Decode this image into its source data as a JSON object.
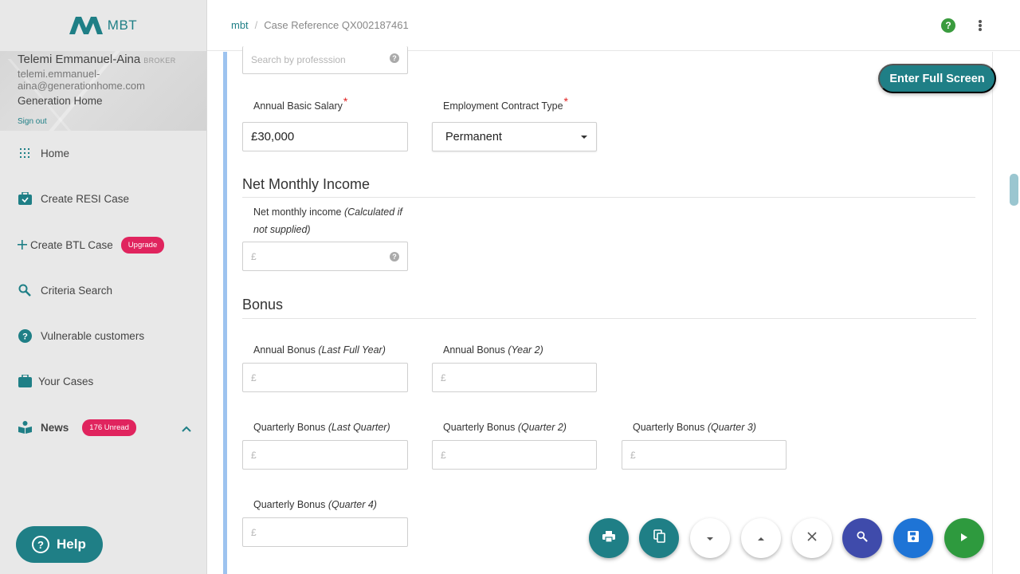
{
  "app": {
    "logo_text": "MBT"
  },
  "user": {
    "name": "Telemi Emmanuel-Aina",
    "role": "BROKER",
    "email": "telemi.emmanuel-aina@generationhome.com",
    "company": "Generation Home",
    "signout_label": "Sign out"
  },
  "nav": {
    "home": "Home",
    "create_resi": "Create RESI Case",
    "create_btl": "Create BTL Case",
    "create_btl_badge": "Upgrade",
    "criteria_search": "Criteria Search",
    "vulnerable": "Vulnerable customers",
    "your_cases": "Your Cases",
    "news": "News",
    "news_badge": "176 Unread"
  },
  "help_label": "Help",
  "breadcrumb": {
    "root": "mbt",
    "separator": "/",
    "current": "Case Reference QX002187461"
  },
  "fullscreen_label": "Enter Full Screen",
  "form": {
    "profession_placeholder": "Search by professsion",
    "salary": {
      "label": "Annual Basic Salary",
      "required": "*",
      "value": "£30,000"
    },
    "contract": {
      "label": "Employment Contract Type",
      "required": "*",
      "value": "Permanent"
    },
    "net_section_title": "Net Monthly Income",
    "net_income": {
      "label": "Net monthly income",
      "label_note_1": "(Calculated if",
      "label_note_2": "not supplied)",
      "placeholder": "£"
    },
    "bonus_section_title": "Bonus",
    "annual_bonus_last": {
      "label": "Annual Bonus",
      "note": "(Last Full Year)",
      "placeholder": "£"
    },
    "annual_bonus_y2": {
      "label": "Annual Bonus",
      "note": "(Year 2)",
      "placeholder": "£"
    },
    "q_bonus_last": {
      "label": "Quarterly Bonus",
      "note": "(Last Quarter)",
      "placeholder": "£"
    },
    "q_bonus_2": {
      "label": "Quarterly Bonus",
      "note": "(Quarter 2)",
      "placeholder": "£"
    },
    "q_bonus_3": {
      "label": "Quarterly Bonus",
      "note": "(Quarter 3)",
      "placeholder": "£"
    },
    "q_bonus_4": {
      "label": "Quarterly Bonus",
      "note": "(Quarter 4)",
      "placeholder": "£"
    }
  },
  "icons": {
    "help": "question-mark-icon",
    "more": "vertical-dots-icon",
    "print": "print-icon",
    "copy": "copy-icon",
    "down": "caret-down-icon",
    "up": "caret-up-icon",
    "close": "close-icon",
    "search": "search-icon",
    "save": "save-icon",
    "next": "play-icon"
  },
  "colors": {
    "brand": "#1f7f86",
    "badge": "#e0245e",
    "required": "#e02020",
    "card_accent": "#9dc3ef",
    "search_fab": "#3f4bab",
    "save_fab": "#1e74d6",
    "next_fab": "#2e9a3e"
  }
}
